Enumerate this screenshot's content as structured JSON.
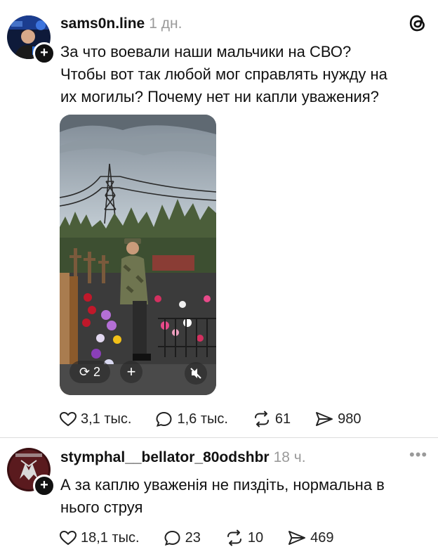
{
  "post": {
    "username": "sams0n.line",
    "time": "1 дн.",
    "text_lines": [
      "За что воевали наши мальчики на СВО?",
      "Чтобы вот так любой мог справлять нужду на",
      "их могилы? Почему нет ни капли уважения?"
    ],
    "media": {
      "repost_count": "2",
      "add_label": "+",
      "mute_icon": "speaker-muted-icon"
    },
    "actions": {
      "likes": "3,1 тыс.",
      "comments": "1,6 тыс.",
      "reposts": "61",
      "shares": "980"
    }
  },
  "reply": {
    "username": "stymphal__bellator_80odshbr",
    "time": "18 ч.",
    "more": "•••",
    "text_lines": [
      "А за каплю уваженія не пиздіть, нормальна в",
      "нього струя"
    ],
    "actions": {
      "likes": "18,1 тыс.",
      "comments": "23",
      "reposts": "10",
      "shares": "469"
    }
  },
  "icons": {
    "app_logo": "threads-logo-icon",
    "like": "heart-icon",
    "comment": "comment-bubble-icon",
    "repost": "repost-arrows-icon",
    "share": "send-arrow-icon",
    "follow": "plus-icon"
  },
  "colors": {
    "text": "#111111",
    "secondary": "#9a9a9a",
    "divider": "#dcdcdc"
  }
}
